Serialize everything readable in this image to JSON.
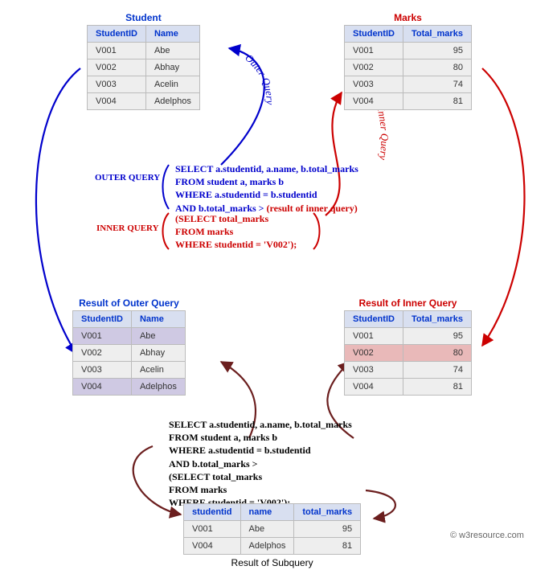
{
  "tables": {
    "student": {
      "title": "Student",
      "headers": [
        "StudentID",
        "Name"
      ],
      "rows": [
        [
          "V001",
          "Abe"
        ],
        [
          "V002",
          "Abhay"
        ],
        [
          "V003",
          "Acelin"
        ],
        [
          "V004",
          "Adelphos"
        ]
      ]
    },
    "marks": {
      "title": "Marks",
      "headers": [
        "StudentID",
        "Total_marks"
      ],
      "rows": [
        [
          "V001",
          "95"
        ],
        [
          "V002",
          "80"
        ],
        [
          "V003",
          "74"
        ],
        [
          "V004",
          "81"
        ]
      ]
    },
    "outer_result": {
      "title": "Result of Outer Query",
      "headers": [
        "StudentID",
        "Name"
      ],
      "rows": [
        [
          "V001",
          "Abe"
        ],
        [
          "V002",
          "Abhay"
        ],
        [
          "V003",
          "Acelin"
        ],
        [
          "V004",
          "Adelphos"
        ]
      ],
      "highlight_indices": [
        0,
        3
      ]
    },
    "inner_result": {
      "title": "Result of Inner Query",
      "headers": [
        "StudentID",
        "Total_marks"
      ],
      "rows": [
        [
          "V001",
          "95"
        ],
        [
          "V002",
          "80"
        ],
        [
          "V003",
          "74"
        ],
        [
          "V004",
          "81"
        ]
      ],
      "highlight_index": 1
    },
    "final_result": {
      "title": "Result of Subquery",
      "headers": [
        "studentid",
        "name",
        "total_marks"
      ],
      "rows": [
        [
          "V001",
          "Abe",
          "95"
        ],
        [
          "V004",
          "Adelphos",
          "81"
        ]
      ]
    }
  },
  "labels": {
    "outer_query_side": "OUTER QUERY",
    "inner_query_side": "INNER QUERY",
    "outer_curve": "Outer Query",
    "inner_curve": "Inner Query"
  },
  "query": {
    "outer": {
      "line1": "SELECT a.studentid, a.name, b.total_marks",
      "line2": "FROM student a, marks b",
      "line3": "WHERE a.studentid = b.studentid",
      "line4a": "AND b.total_marks > ",
      "line4b": "(result of inner query)"
    },
    "inner": {
      "line1": "(SELECT total_marks",
      "line2": "FROM marks",
      "line3": "WHERE studentid =  'V002');"
    },
    "full": {
      "line1": "SELECT a.studentid, a.name, b.total_marks",
      "line2": "FROM student a, marks b",
      "line3": "WHERE a.studentid = b.studentid",
      "line4": "AND b.total_marks >",
      "line5": "(SELECT total_marks",
      "line6": "FROM marks",
      "line7": "WHERE studentid =  'V002');"
    }
  },
  "attribution": "© w3resource.com"
}
